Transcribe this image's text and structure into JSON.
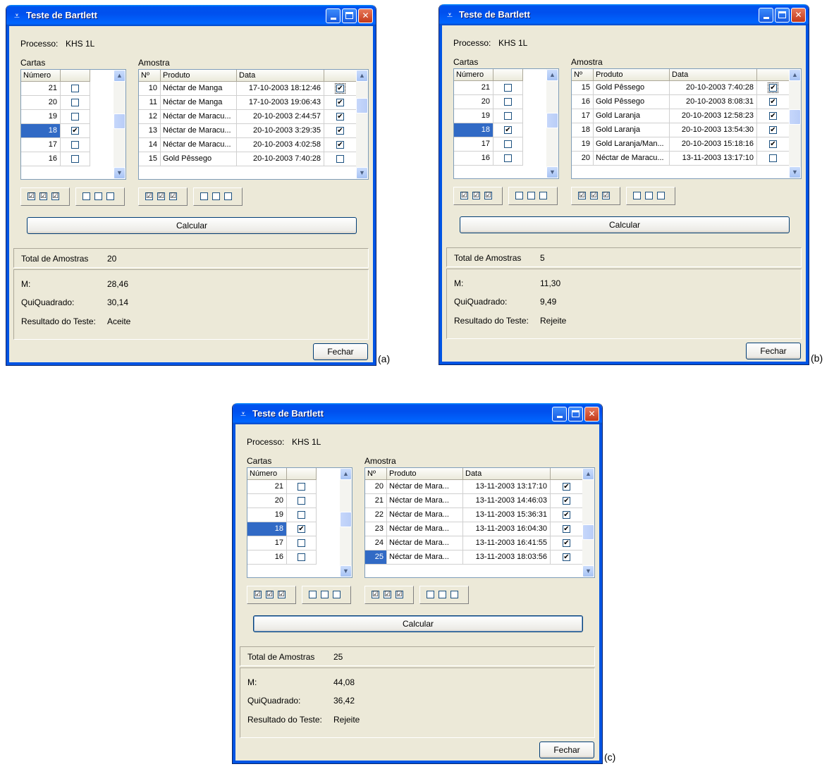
{
  "title": "Teste de Bartlett",
  "labels": {
    "processo": "Processo:",
    "cartas": "Cartas",
    "amostra": "Amostra",
    "col_numero": "Número",
    "col_n": "Nº",
    "col_produto": "Produto",
    "col_data": "Data",
    "calcular": "Calcular",
    "total": "Total de Amostras",
    "m": "M:",
    "qui": "QuiQuadrado:",
    "resultado": "Resultado do Teste:",
    "fechar": "Fechar"
  },
  "processo": "KHS 1L",
  "icons": {
    "check_on": "☑",
    "check_off": "☐"
  },
  "windows": [
    {
      "caption": "(a)",
      "cartas": [
        {
          "num": "21",
          "checked": false,
          "selected": false
        },
        {
          "num": "20",
          "checked": false,
          "selected": false
        },
        {
          "num": "19",
          "checked": false,
          "selected": false
        },
        {
          "num": "18",
          "checked": true,
          "selected": true
        },
        {
          "num": "17",
          "checked": false,
          "selected": false
        },
        {
          "num": "16",
          "checked": false,
          "selected": false
        }
      ],
      "amostra": [
        {
          "n": "10",
          "produto": "Néctar de Manga",
          "data": "17-10-2003 18:12:46",
          "checked": true,
          "selected": false,
          "focus": true
        },
        {
          "n": "11",
          "produto": "Néctar de Manga",
          "data": "17-10-2003 19:06:43",
          "checked": true,
          "selected": false
        },
        {
          "n": "12",
          "produto": "Néctar de Maracu...",
          "data": "20-10-2003 2:44:57",
          "checked": true,
          "selected": false
        },
        {
          "n": "13",
          "produto": "Néctar de Maracu...",
          "data": "20-10-2003 3:29:35",
          "checked": true,
          "selected": false
        },
        {
          "n": "14",
          "produto": "Néctar de Maracu...",
          "data": "20-10-2003 4:02:58",
          "checked": true,
          "selected": false
        },
        {
          "n": "15",
          "produto": "Gold Pêssego",
          "data": "20-10-2003 7:40:28",
          "checked": false,
          "selected": false
        }
      ],
      "total": "20",
      "m": "28,46",
      "qui": "30,14",
      "resultado": "Aceite"
    },
    {
      "caption": "(b)",
      "cartas": [
        {
          "num": "21",
          "checked": false,
          "selected": false
        },
        {
          "num": "20",
          "checked": false,
          "selected": false
        },
        {
          "num": "19",
          "checked": false,
          "selected": false
        },
        {
          "num": "18",
          "checked": true,
          "selected": true
        },
        {
          "num": "17",
          "checked": false,
          "selected": false
        },
        {
          "num": "16",
          "checked": false,
          "selected": false
        }
      ],
      "amostra": [
        {
          "n": "15",
          "produto": "Gold Pêssego",
          "data": "20-10-2003 7:40:28",
          "checked": true,
          "selected": false,
          "focus": true
        },
        {
          "n": "16",
          "produto": "Gold Pêssego",
          "data": "20-10-2003 8:08:31",
          "checked": true,
          "selected": false
        },
        {
          "n": "17",
          "produto": "Gold Laranja",
          "data": "20-10-2003 12:58:23",
          "checked": true,
          "selected": false
        },
        {
          "n": "18",
          "produto": "Gold Laranja",
          "data": "20-10-2003 13:54:30",
          "checked": true,
          "selected": false
        },
        {
          "n": "19",
          "produto": "Gold Laranja/Man...",
          "data": "20-10-2003 15:18:16",
          "checked": true,
          "selected": false
        },
        {
          "n": "20",
          "produto": "Néctar de Maracu...",
          "data": "13-11-2003 13:17:10",
          "checked": false,
          "selected": false
        }
      ],
      "total": "5",
      "m": "11,30",
      "qui": "9,49",
      "resultado": "Rejeite"
    },
    {
      "caption": "(c)",
      "cartas": [
        {
          "num": "21",
          "checked": false,
          "selected": false
        },
        {
          "num": "20",
          "checked": false,
          "selected": false
        },
        {
          "num": "19",
          "checked": false,
          "selected": false
        },
        {
          "num": "18",
          "checked": true,
          "selected": true
        },
        {
          "num": "17",
          "checked": false,
          "selected": false
        },
        {
          "num": "16",
          "checked": false,
          "selected": false
        }
      ],
      "amostra": [
        {
          "n": "20",
          "produto": "Néctar de Mara...",
          "data": "13-11-2003 13:17:10",
          "checked": true,
          "selected": false
        },
        {
          "n": "21",
          "produto": "Néctar de Mara...",
          "data": "13-11-2003 14:46:03",
          "checked": true,
          "selected": false
        },
        {
          "n": "22",
          "produto": "Néctar de Mara...",
          "data": "13-11-2003 15:36:31",
          "checked": true,
          "selected": false
        },
        {
          "n": "23",
          "produto": "Néctar de Mara...",
          "data": "13-11-2003 16:04:30",
          "checked": true,
          "selected": false
        },
        {
          "n": "24",
          "produto": "Néctar de Mara...",
          "data": "13-11-2003 16:41:55",
          "checked": true,
          "selected": false
        },
        {
          "n": "25",
          "produto": "Néctar de Mara...",
          "data": "13-11-2003 18:03:56",
          "checked": true,
          "selected": true
        }
      ],
      "total": "25",
      "m": "44,08",
      "qui": "36,42",
      "resultado": "Rejeite"
    }
  ]
}
